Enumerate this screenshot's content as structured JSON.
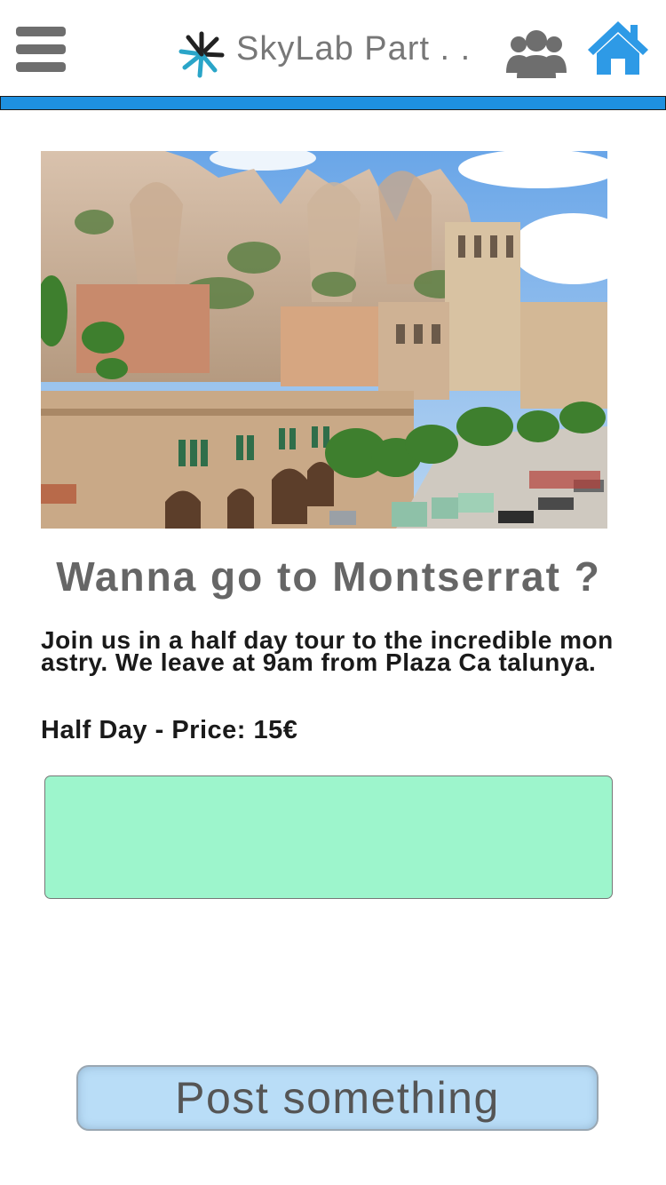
{
  "header": {
    "app_title": "SkyLab Part . .",
    "icons": [
      "menu-icon",
      "skylab-logo-icon",
      "users-icon",
      "home-icon"
    ],
    "accent_color": "#1e90e0"
  },
  "progress": {
    "fraction": 1.0
  },
  "post": {
    "image_subject": "montserrat-monastery-photo",
    "title": "Wanna go to Montserrat ?",
    "description": "Join us in a half day tour to the incredible monastry. We leave at 9am from Plaza Ca talunya.",
    "price": "Half Day - Price: 15€"
  },
  "comment": {
    "value": "",
    "background": "#9df5cc"
  },
  "actions": {
    "post_label": "Post something",
    "button_color": "#b9ddf7"
  }
}
